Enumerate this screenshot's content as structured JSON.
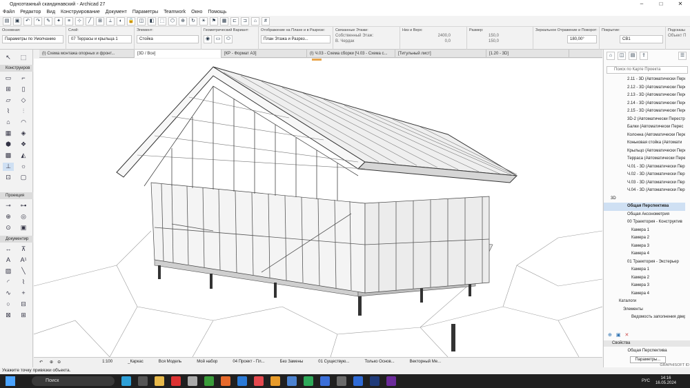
{
  "window": {
    "title": "Одноэтажный скандинавский - Archicad 27"
  },
  "menu": [
    "Файл",
    "Редактор",
    "Вид",
    "Конструирование",
    "Документ",
    "Параметры",
    "Teamwork",
    "Окно",
    "Помощь"
  ],
  "infobox": {
    "basic_label": "Основная:",
    "basic_value": "Параметры по Умолчанию",
    "layer_label": "Слой:",
    "layer_value": "07 Террасы и крыльца 1",
    "element_label": "Элемент:",
    "element_value": "Стойка",
    "geom_label": "Геометрический Вариант:",
    "display_label": "Отображение на Плане и в Разрезе:",
    "display_value": "План Этажа и Разрез...",
    "stories_label": "Связанные Этажи:",
    "stories_value": "Собственный Этаж:",
    "stories_sub": "В. Чердак",
    "bottom_top_label": "Низ и Верх:",
    "top_value": "2400,0",
    "bottom_value": "0,0",
    "size_label": "Размер:",
    "size_a": "150,0",
    "size_b": "150,0",
    "mirror_label": "Зеркальное Отражение и Поворот:",
    "angle_value": "180,00°",
    "cover_label": "Покрытие:",
    "cover_value": "СВ1",
    "sub_label": "Подсказы",
    "sub_value": "Объект П"
  },
  "tabs": [
    "(I) Схема монтажа опорных и фронт...",
    "[3D / Все]",
    "[КР - Формат А3]",
    "(I) Ч.03 - Схема сборки [Ч.03 - Схема с...",
    "[Титульный лист]",
    "[1.20 - 3D]"
  ],
  "left_sections": {
    "construct": "Конструиров",
    "projection": "Проекция",
    "document": "Документир"
  },
  "statusbar": {
    "scale": "1:100",
    "layer_combo": "_Каркас",
    "model": "Вся Модель",
    "pen_set": "Мой набор",
    "mvo": "04 Проект - Пл...",
    "override": "Без Замены",
    "renovation": "01 Существую...",
    "structural": "Только Основ...",
    "vector": "Векторный Ме..."
  },
  "navigator": {
    "search_placeholder": "Поиск по Карте Проекта",
    "items": [
      "2.11 - 3D (Автоматически Пере",
      "2.12 - 3D (Автоматически Пере",
      "2.13 - 3D (Автоматически Пере",
      "2.14 - 3D (Автоматически Пере",
      "2.15 - 3D (Автоматически Пере",
      "3D-2 (Автоматически Перестр",
      "Балки (Автоматически Перес",
      "Колонна (Автоматически Пере",
      "Коньковая стойка (Автомати",
      "Крыльцо (Автоматически Пере",
      "Терраса (Автоматически Пере",
      "Ч.01 - 3D (Автоматически Пер",
      "Ч.02 - 3D (Автоматически Пер",
      "Ч.03 - 3D (Автоматически Пер",
      "Ч.04 - 3D (Автоматически Пер",
      "3D",
      "Общая Перспектива",
      "Общая Аксонометрия",
      "00 Траектория - Конструктив",
      "Камера 1",
      "Камера 2",
      "Камера 3",
      "Камера 4",
      "01 Траектория - Экстерьер",
      "Камера 1",
      "Камера 2",
      "Камера 3",
      "Камера 4",
      "Каталоги",
      "Элементы",
      "Ведомость заполнения двер"
    ],
    "props_title": "Свойства",
    "props_value": "Общая Перспектива",
    "params_button": "Параметры..."
  },
  "hint": "Укажите точку привязки объекта.",
  "taskbar": {
    "search": "Поиск",
    "lang": "РУС",
    "time": "14:16",
    "date": "16.05.2024",
    "watermark": "GRAPHISOFT ID"
  }
}
